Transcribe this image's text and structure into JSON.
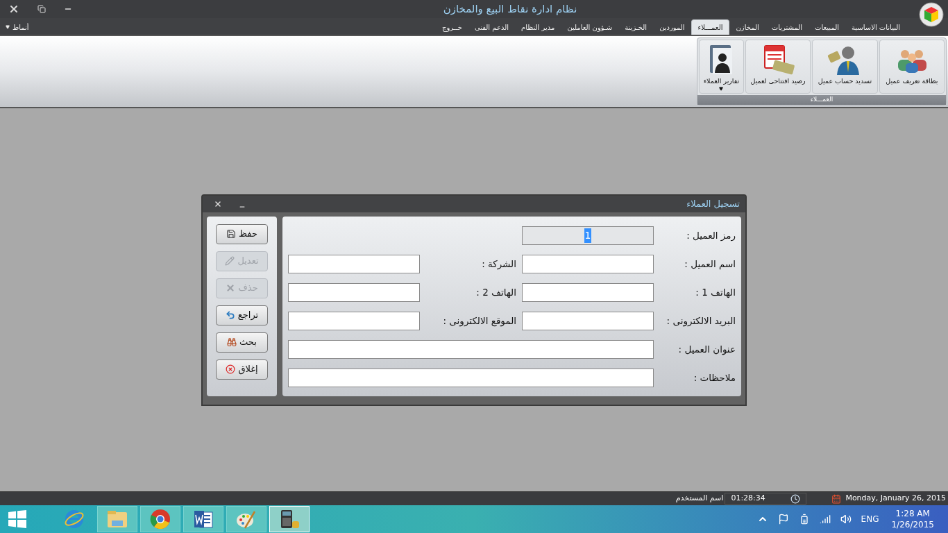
{
  "window": {
    "title": "نظام ادارة نقاط البيع والمخازن"
  },
  "menu_tabs": [
    {
      "label": "البيانات الاساسية",
      "selected": false
    },
    {
      "label": "المبيعات",
      "selected": false
    },
    {
      "label": "المشتريات",
      "selected": false
    },
    {
      "label": "المخازن",
      "selected": false
    },
    {
      "label": "العمـــلاء",
      "selected": true
    },
    {
      "label": "الموردين",
      "selected": false
    },
    {
      "label": "الخـزينة",
      "selected": false
    },
    {
      "label": "شـؤون العاملين",
      "selected": false
    },
    {
      "label": "مدير النظام",
      "selected": false
    },
    {
      "label": "الدعم الفنى",
      "selected": false
    },
    {
      "label": "خــروج",
      "selected": false
    }
  ],
  "styles_menu": {
    "label": "أنماط"
  },
  "ribbon": {
    "group_label": "العمـــلاء",
    "buttons": [
      {
        "label": "بطاقة تعريف عميل",
        "kind": "people",
        "dropdown": false
      },
      {
        "label": "تسديد حساب عميل",
        "kind": "payment",
        "dropdown": false
      },
      {
        "label": "رصيد افتتاحى لعميل",
        "kind": "calendar",
        "dropdown": false
      },
      {
        "label": "تقارير العملاء",
        "kind": "reports",
        "dropdown": true
      }
    ]
  },
  "dialog": {
    "title": "تسجيل العملاء",
    "rows": [
      {
        "fields": [
          {
            "label": "رمز العميل :",
            "value": "1",
            "readonly": true,
            "value_selected": true,
            "wide": false
          }
        ]
      },
      {
        "fields": [
          {
            "label": "اسم العميل :",
            "readonly": false,
            "wide": false
          },
          {
            "label": "الشركة :",
            "readonly": false,
            "wide": false
          }
        ]
      },
      {
        "fields": [
          {
            "label": "الهاتف 1 :",
            "readonly": false,
            "wide": false
          },
          {
            "label": "الهاتف 2 :",
            "readonly": false,
            "wide": false
          }
        ]
      },
      {
        "fields": [
          {
            "label": "البريد الالكترونى :",
            "readonly": false,
            "wide": false
          },
          {
            "label": "الموقع الالكترونى :",
            "readonly": false,
            "wide": false
          }
        ]
      },
      {
        "fields": [
          {
            "label": "عنوان العميل :",
            "readonly": false,
            "wide": true
          }
        ]
      },
      {
        "fields": [
          {
            "label": "ملاحظات :",
            "readonly": false,
            "wide": true
          }
        ]
      }
    ],
    "buttons": [
      {
        "label": "حفظ",
        "kind": "save",
        "disabled": false
      },
      {
        "label": "تعديل",
        "kind": "edit",
        "disabled": true
      },
      {
        "label": "حذف",
        "kind": "delete",
        "disabled": true
      },
      {
        "label": "تراجع",
        "kind": "undo",
        "disabled": false
      },
      {
        "label": "بحث",
        "kind": "search",
        "disabled": false
      },
      {
        "label": "إغلاق",
        "kind": "close",
        "disabled": false
      }
    ]
  },
  "status_bar": {
    "date": "Monday, January 26, 2015",
    "clock": "01:28:34",
    "user_label": "اسم المستخدم"
  },
  "taskbar": {
    "apps": [
      {
        "kind": "browser-e",
        "active": false
      },
      {
        "kind": "folder",
        "active": false
      },
      {
        "kind": "chrome",
        "active": false
      },
      {
        "kind": "word",
        "active": false
      },
      {
        "kind": "palette",
        "active": false
      },
      {
        "kind": "calculator",
        "active": true
      }
    ],
    "language": "ENG",
    "time": "1:28 AM",
    "date": "1/26/2015"
  }
}
